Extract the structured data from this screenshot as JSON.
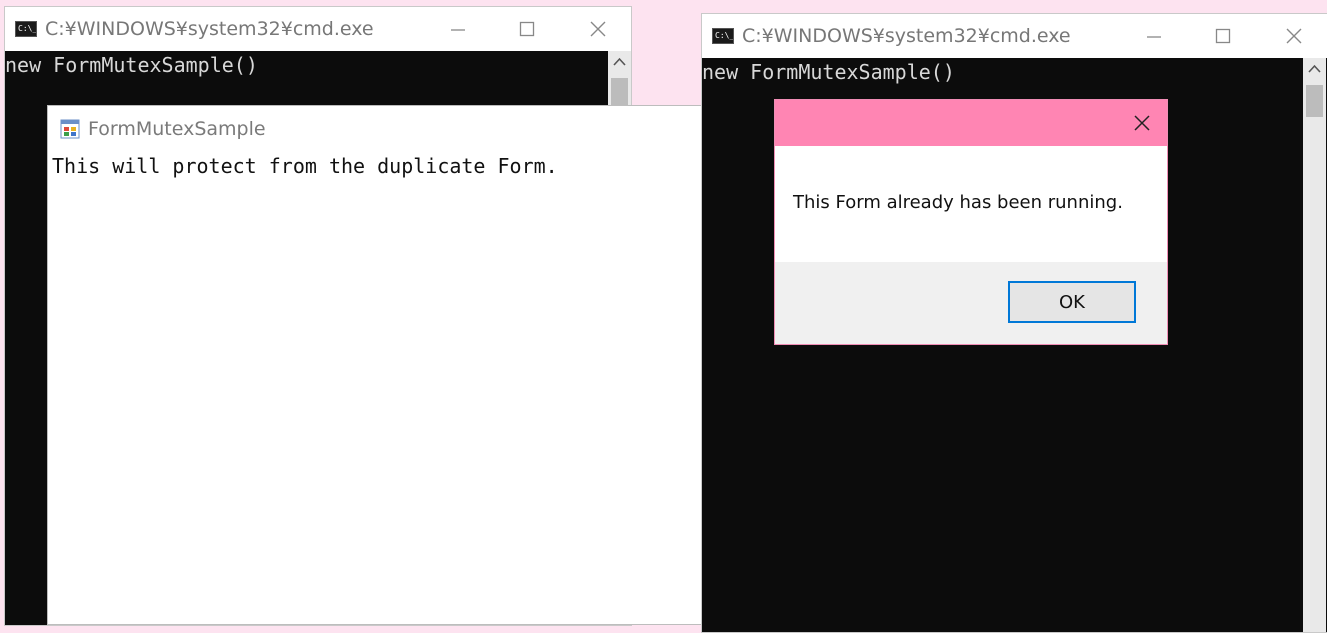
{
  "cmd_window_left": {
    "title": "C:¥WINDOWS¥system32¥cmd.exe",
    "console_line": "new FormMutexSample()",
    "icon": "cmd-icon"
  },
  "cmd_window_right": {
    "title": "C:¥WINDOWS¥system32¥cmd.exe",
    "console_line": "new FormMutexSample()",
    "icon": "cmd-icon"
  },
  "form_window": {
    "title": "FormMutexSample",
    "body_text": "This will protect from the duplicate Form.",
    "icon": "form-app-icon"
  },
  "message_box": {
    "message": "This Form already has been running.",
    "ok_label": "OK",
    "title_color": "#ff85b3"
  },
  "colors": {
    "desktop": "#fde3f0",
    "console_bg": "#0c0c0c",
    "accent": "#0078d7"
  }
}
